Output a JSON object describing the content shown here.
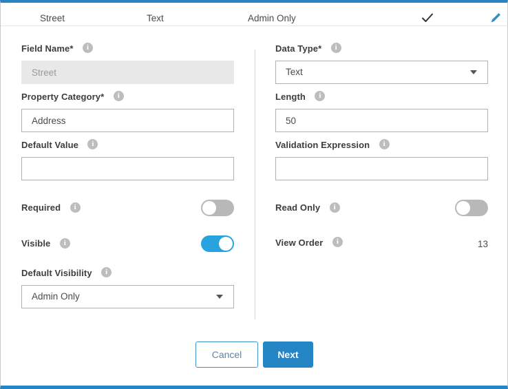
{
  "header": {
    "field_name": "Street",
    "data_type": "Text",
    "visibility": "Admin Only",
    "check_icon": "check-icon",
    "edit_icon": "pencil-icon"
  },
  "left_column": {
    "field_name": {
      "label": "Field Name",
      "required_mark": "*",
      "value": "Street",
      "info": "info-icon",
      "disabled": true
    },
    "property_category": {
      "label": "Property Category",
      "required_mark": "*",
      "value": "Address",
      "info": "info-icon"
    },
    "default_value": {
      "label": "Default Value",
      "value": "",
      "placeholder": "",
      "info": "info-icon"
    },
    "required_toggle": {
      "label": "Required",
      "state": "off",
      "info": "info-icon"
    },
    "visible_toggle": {
      "label": "Visible",
      "state": "on",
      "info": "info-icon"
    },
    "default_visibility": {
      "label": "Default Visibility",
      "value": "Admin Only",
      "info": "info-icon",
      "caret": "chevron-down-icon"
    }
  },
  "right_column": {
    "data_type": {
      "label": "Data Type",
      "required_mark": "*",
      "value": "Text",
      "info": "info-icon",
      "caret": "chevron-down-icon"
    },
    "length": {
      "label": "Length",
      "value": "50",
      "info": "info-icon"
    },
    "validation_expression": {
      "label": "Validation Expression",
      "value": "",
      "placeholder": "",
      "info": "info-icon"
    },
    "read_only_toggle": {
      "label": "Read Only",
      "state": "off",
      "info": "info-icon"
    },
    "view_order": {
      "label": "View Order",
      "value": "13",
      "info": "info-icon"
    }
  },
  "footer": {
    "cancel_label": "Cancel",
    "next_label": "Next"
  },
  "colors": {
    "accent_blue": "#2585c4",
    "toggle_on": "#29a3e0",
    "toggle_off": "#b8b8b8",
    "border_grey": "#b0b0b0",
    "disabled_bg": "#e8e8e8"
  }
}
